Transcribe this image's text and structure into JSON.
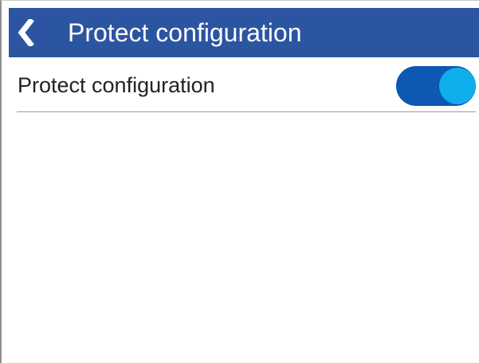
{
  "header": {
    "title": "Protect configuration",
    "back_icon": "chevron-left-icon"
  },
  "settings": {
    "protect_configuration": {
      "label": "Protect configuration",
      "enabled": true
    }
  },
  "colors": {
    "header_background": "#2c55a1",
    "toggle_track": "#0c58b2",
    "toggle_knob": "#10aeea",
    "divider": "#9b9b9b"
  }
}
